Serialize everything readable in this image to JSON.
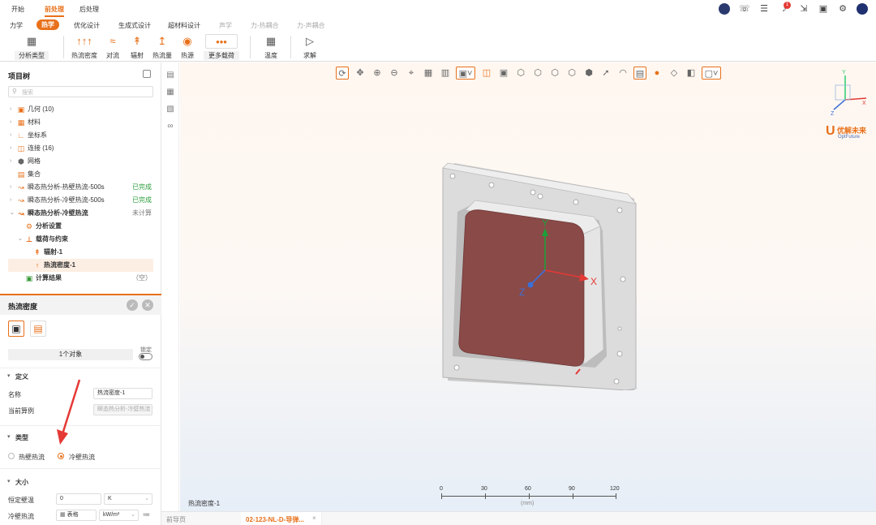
{
  "menu": {
    "items": [
      "开始",
      "前处理",
      "后处理"
    ],
    "active": "前处理"
  },
  "top_icons": [
    "avatar-badge-icon",
    "headset-icon",
    "list-icon",
    "bell-icon",
    "fullscreen-icon",
    "chat-icon",
    "gear-icon",
    "user-avatar-icon"
  ],
  "notification_count": "1",
  "subtabs": {
    "items": [
      "力学",
      "热学",
      "优化设计",
      "生成式设计",
      "超材料设计",
      "声学",
      "力-热耦合",
      "力-声耦合"
    ],
    "active": "热学",
    "disabled": [
      "声学",
      "力-热耦合",
      "力-声耦合"
    ]
  },
  "ribbon": {
    "analysis_type": "分析类型",
    "heat_flux_density": "热流密度",
    "convection": "对流",
    "radiation": "辐射",
    "heat_flow": "热流量",
    "heat_source": "热源",
    "more_loads": "更多载荷",
    "temperature": "温度",
    "solve": "求解"
  },
  "project_tree": {
    "title": "项目树",
    "search_placeholder": "搜索",
    "items": [
      {
        "label": "几何 (10)",
        "icon": "cube-icon"
      },
      {
        "label": "材料",
        "icon": "material-icon"
      },
      {
        "label": "坐标系",
        "icon": "axes-icon"
      },
      {
        "label": "连接 (16)",
        "icon": "link-icon"
      },
      {
        "label": "网格",
        "icon": "mesh-icon"
      },
      {
        "label": "集合",
        "icon": "folder-icon"
      },
      {
        "label": "瞬态热分析-热壁热流-500s",
        "icon": "analysis-icon",
        "status": "已完成"
      },
      {
        "label": "瞬态热分析-冷壁热流-500s",
        "icon": "analysis-icon",
        "status": "已完成"
      },
      {
        "label": "瞬态热分析-冷壁热流",
        "icon": "analysis-icon",
        "status": "未计算"
      },
      {
        "label": "分析设置",
        "icon": "settings-icon"
      },
      {
        "label": "载荷与约束",
        "icon": "load-icon"
      },
      {
        "label": "辐射-1",
        "icon": "radiation-icon"
      },
      {
        "label": "热流密度-1",
        "icon": "flux-icon"
      },
      {
        "label": "计算结果",
        "icon": "result-icon",
        "status": "（空）"
      }
    ]
  },
  "properties": {
    "title": "热流密度",
    "object_count": "1个对象",
    "lock_label": "锁定",
    "definition": {
      "header": "定义",
      "name_label": "名称",
      "name_value": "热流密度-1",
      "case_label": "当前算例",
      "case_value": "瞬态热分析-冷壁热流"
    },
    "type": {
      "header": "类型",
      "option_hot": "热壁热流",
      "option_cold": "冷壁热流",
      "selected": "冷壁热流"
    },
    "size": {
      "header": "大小",
      "wall_temp_label": "恒定壁温",
      "wall_temp_value": "0",
      "wall_temp_unit": "K",
      "cold_flux_label": "冷壁热流",
      "cold_flux_mode": "表格",
      "cold_flux_unit": "kW/m²"
    }
  },
  "viewport": {
    "axes": {
      "x": "X",
      "y": "Y",
      "z": "Z"
    },
    "logo_text": "优解未来",
    "logo_sub": "OptFuture",
    "scale": {
      "ticks": [
        "0",
        "30",
        "60",
        "90",
        "120"
      ],
      "unit": "(mm)"
    },
    "status_label": "热流密度-1"
  },
  "bottom_tabs": {
    "home": "前导页",
    "active": "02-123-NL-D-导弹..."
  },
  "colors": {
    "accent": "#e8701a",
    "face": "#8a4a48"
  }
}
